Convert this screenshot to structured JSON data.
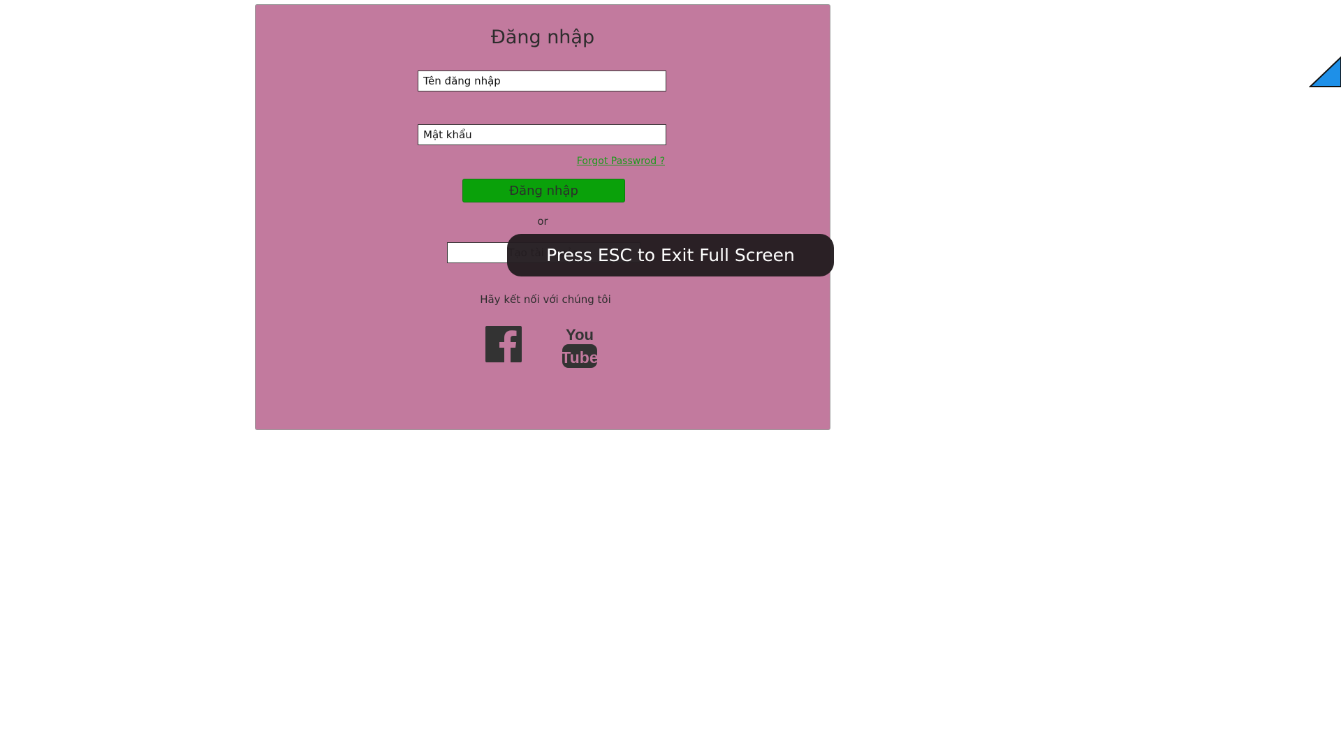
{
  "login": {
    "title": "Đăng nhập",
    "username_placeholder": "Tên đăng nhập",
    "password_placeholder": "Mật khẩu",
    "forgot_password": "Forgot Passwrod ?",
    "login_button": "Đăng nhập",
    "or_text": "or",
    "register_button": "Tạo tài khoản",
    "connect_text": "Hãy kết nối với chúng tôi"
  },
  "social": {
    "facebook_icon": "facebook-icon",
    "youtube_icon": "youtube-icon",
    "youtube_you": "You",
    "youtube_tube": "Tube"
  },
  "overlay": {
    "fullscreen_message": "Press ESC to Exit Full Screen"
  },
  "colors": {
    "panel_background": "#c27a9e",
    "login_button": "#0aa10a",
    "forgot_link": "#1b9a1b",
    "toast_background": "#231c20",
    "corner_arrow": "#1e90e8"
  }
}
